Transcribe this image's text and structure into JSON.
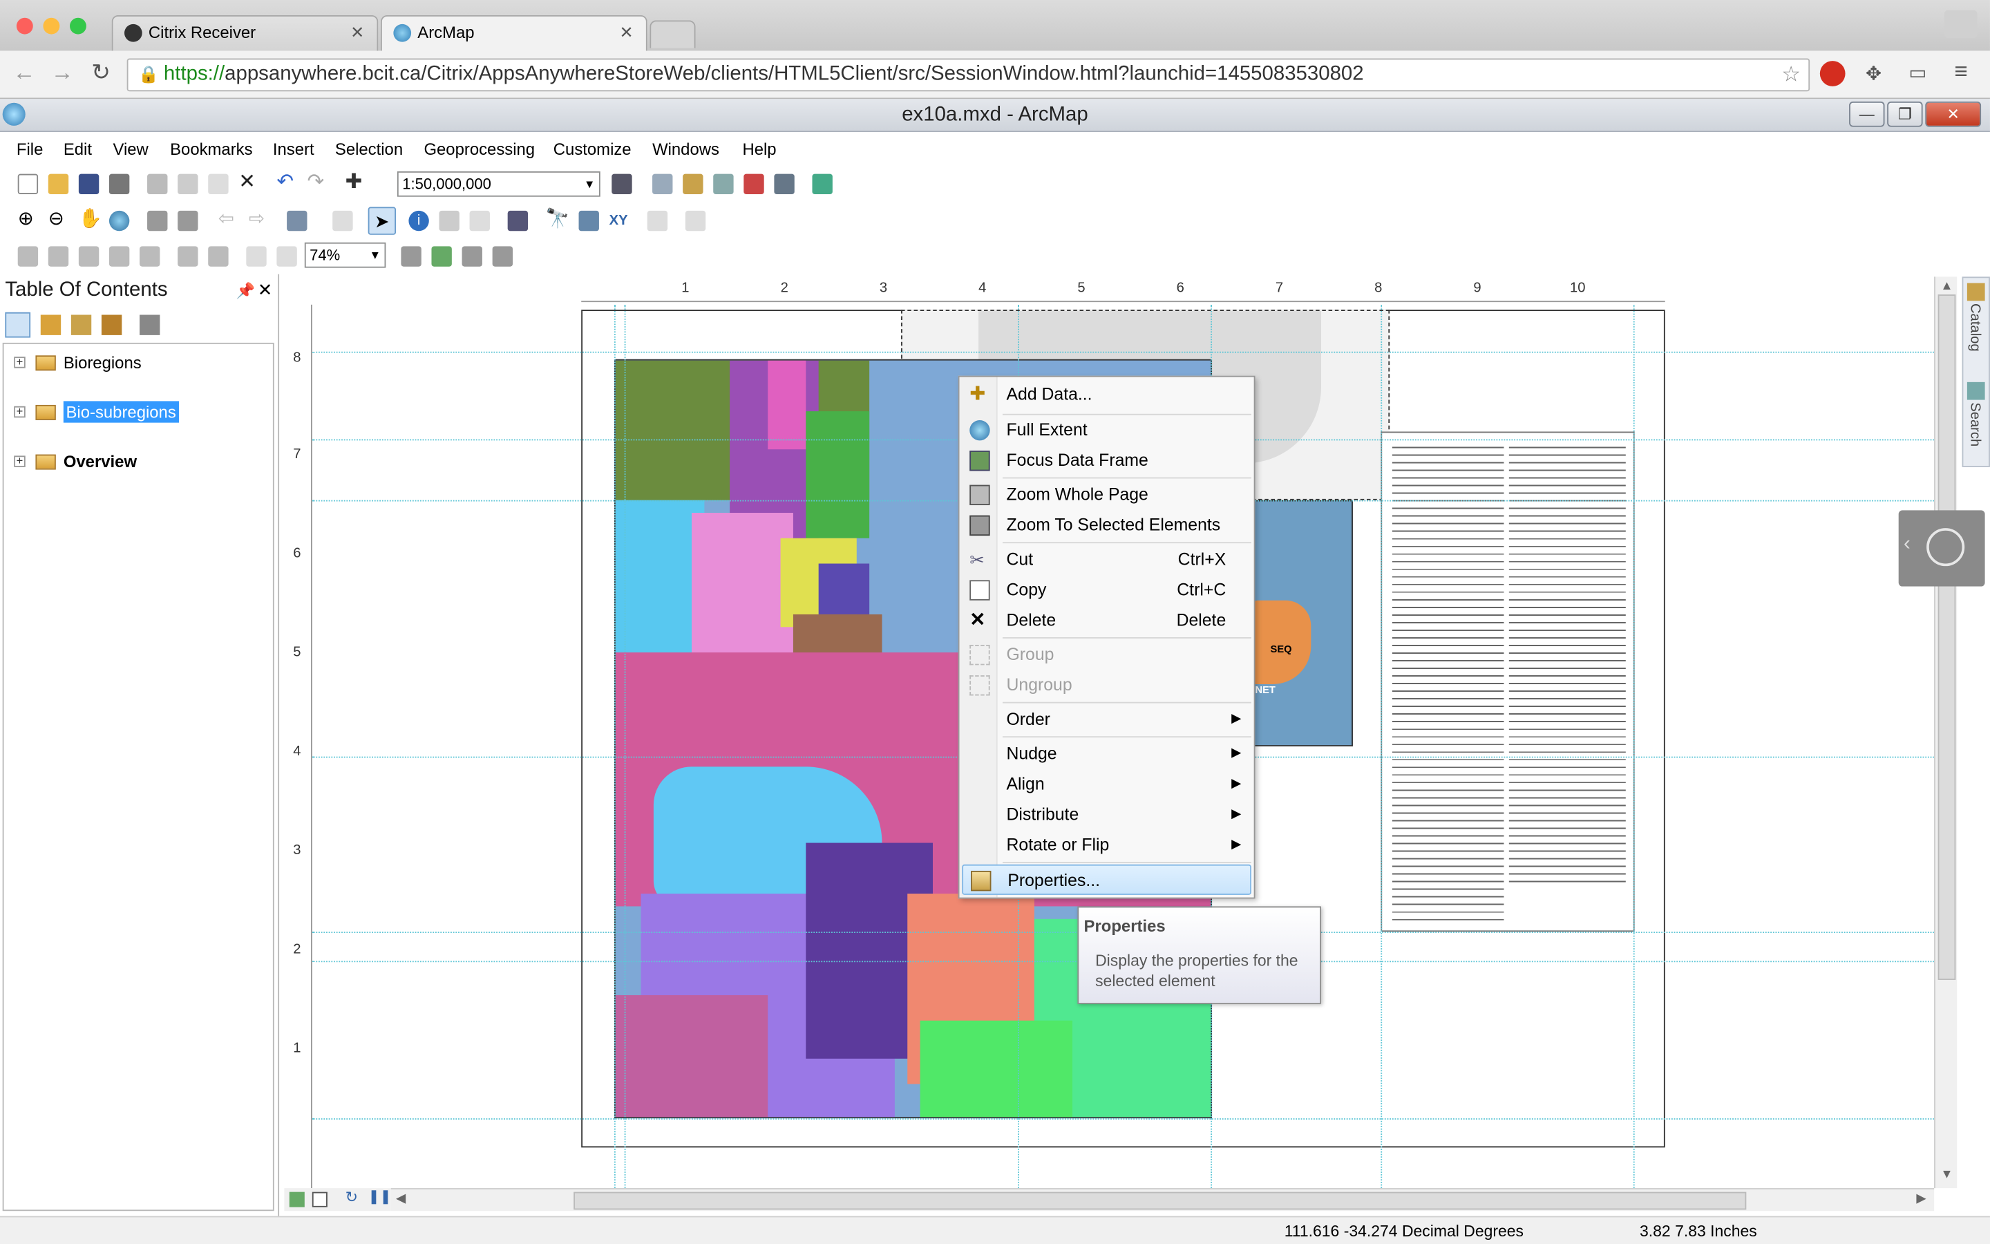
{
  "browser": {
    "tabs": [
      {
        "label": "Citrix Receiver",
        "active": false
      },
      {
        "label": "ArcMap",
        "active": true
      }
    ],
    "url_secure": "https://",
    "url_rest": "appsanywhere.bcit.ca/Citrix/AppsAnywhereStoreWeb/clients/HTML5Client/src/SessionWindow.html?launchid=1455083530802"
  },
  "window": {
    "title": "ex10a.mxd - ArcMap",
    "buttons": {
      "minimize": "—",
      "restore": "❐",
      "close": "✕"
    }
  },
  "menu": [
    "File",
    "Edit",
    "View",
    "Bookmarks",
    "Insert",
    "Selection",
    "Geoprocessing",
    "Customize",
    "Windows",
    "Help"
  ],
  "toolbar": {
    "scale": "1:50,000,000",
    "zoom": "74%"
  },
  "toc": {
    "title": "Table Of Contents",
    "layers": [
      {
        "name": "Bioregions",
        "selected": false,
        "bold": false
      },
      {
        "name": "Bio-subregions",
        "selected": true,
        "bold": false
      },
      {
        "name": "Overview",
        "selected": false,
        "bold": true
      }
    ]
  },
  "rulers": {
    "horizontal": [
      "1",
      "2",
      "3",
      "4",
      "5",
      "6",
      "7",
      "8",
      "9",
      "10"
    ],
    "vertical": [
      "8",
      "7",
      "6",
      "5",
      "4",
      "3",
      "2",
      "1"
    ]
  },
  "context_menu": {
    "items": [
      {
        "label": "Add Data...",
        "icon": "add-data-icon"
      },
      {
        "label": "Full Extent",
        "icon": "globe-icon"
      },
      {
        "label": "Focus Data Frame",
        "icon": "focus-icon"
      },
      {
        "label": "Zoom Whole Page",
        "icon": "zoom-page-icon"
      },
      {
        "label": "Zoom To Selected Elements",
        "icon": "zoom-selected-icon"
      },
      {
        "label": "Cut",
        "shortcut": "Ctrl+X",
        "icon": "scissors-icon"
      },
      {
        "label": "Copy",
        "shortcut": "Ctrl+C",
        "icon": "copy-icon"
      },
      {
        "label": "Delete",
        "shortcut": "Delete",
        "icon": "delete-icon"
      },
      {
        "label": "Group",
        "disabled": true,
        "icon": "group-icon"
      },
      {
        "label": "Ungroup",
        "disabled": true,
        "icon": "ungroup-icon"
      },
      {
        "label": "Order",
        "submenu": true
      },
      {
        "label": "Nudge",
        "submenu": true
      },
      {
        "label": "Align",
        "submenu": true
      },
      {
        "label": "Distribute",
        "submenu": true
      },
      {
        "label": "Rotate or Flip",
        "submenu": true
      },
      {
        "label": "Properties...",
        "highlighted": true,
        "icon": "properties-icon"
      }
    ]
  },
  "tooltip": {
    "title": "Properties",
    "description": "Display the properties for the selected element"
  },
  "map_labels": [
    "SEQ",
    "NET"
  ],
  "status": {
    "coords": "111.616  -34.274 Decimal Degrees",
    "page_pos": "3.82  7.83 Inches"
  },
  "dock": {
    "catalog": "Catalog",
    "search": "Search"
  },
  "colors": {
    "selection": "#3399ff",
    "guide": "#5fc6d6",
    "menu_highlight": "#c9e4fb"
  }
}
